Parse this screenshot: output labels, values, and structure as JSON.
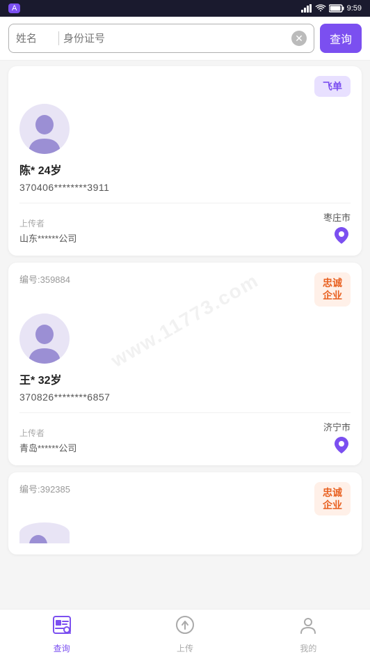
{
  "statusBar": {
    "time": "9:59",
    "appIcon": "A"
  },
  "searchBar": {
    "namePlaceholder": "姓名",
    "idPlaceholder": "身份证号",
    "queryLabel": "查询"
  },
  "watermark": "www.11773.com",
  "cards": [
    {
      "id": null,
      "tagType": "feidan",
      "tagLine1": "飞单",
      "tagLine2": null,
      "name": "陈*",
      "age": "24岁",
      "idNumber": "370406********3911",
      "uploaderLabel": "上传者",
      "uploaderName": "山东******公司",
      "city": "枣庄市"
    },
    {
      "id": "编号:359884",
      "tagType": "zhongcheng",
      "tagLine1": "忠诚",
      "tagLine2": "企业",
      "name": "王*",
      "age": "32岁",
      "idNumber": "370826********6857",
      "uploaderLabel": "上传者",
      "uploaderName": "青岛******公司",
      "city": "济宁市"
    },
    {
      "id": "编号:392385",
      "tagType": "zhongcheng",
      "tagLine1": "忠诚",
      "tagLine2": "企业",
      "name": "",
      "age": "",
      "idNumber": "",
      "uploaderLabel": "",
      "uploaderName": "",
      "city": ""
    }
  ],
  "bottomNav": [
    {
      "label": "查询",
      "icon": "query",
      "active": true
    },
    {
      "label": "上传",
      "icon": "upload",
      "active": false
    },
    {
      "label": "我的",
      "icon": "profile",
      "active": false
    }
  ]
}
